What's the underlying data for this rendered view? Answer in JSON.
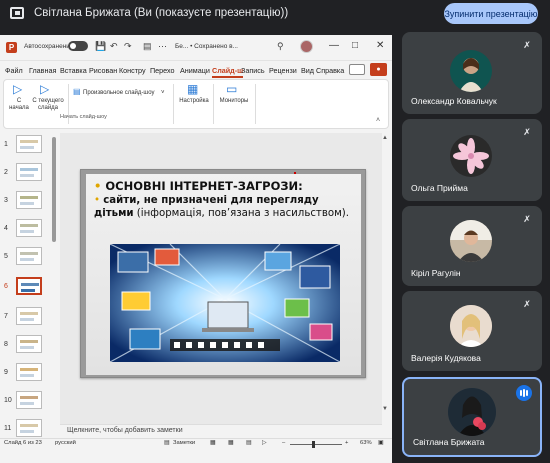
{
  "meeting": {
    "title": "Світлана Брижата (Ви (показуєте презентацію))",
    "stop_button": "Зупинити презентацію"
  },
  "ppt": {
    "autosave_label": "Автосохранение",
    "file_name": "Бе... • Сохранено в...",
    "menu": [
      "Файл",
      "Главная",
      "Вставка",
      "Рисован",
      "Констру",
      "Перехо",
      "Анимаци",
      "Слайд-ш",
      "Запись",
      "Рецензи",
      "Вид",
      "Справка"
    ],
    "active_menu_index": 7,
    "ribbon": {
      "from_start": "С начала",
      "from_current": "С текущего слайда",
      "custom_show": "Произвольное слайд-шоу",
      "settings": "Настройка",
      "monitors": "Мониторы",
      "group_label": "Начать слайд-шоу"
    },
    "thumbnails": [
      "1",
      "2",
      "3",
      "4",
      "5",
      "6",
      "7",
      "8",
      "9",
      "10",
      "11"
    ],
    "active_thumbnail": 6,
    "notes_placeholder": "Щелкните, чтобы добавить заметки",
    "status": {
      "slide_info": "Слайд 6 из 23",
      "language": "русский",
      "notes_label": "Заметки",
      "zoom": "63%"
    }
  },
  "slide": {
    "heading": "ОСНОВНІ ІНТЕРНЕТ-ЗАГРОЗИ:",
    "body_part1": "сайти,  не призначені для перегляду",
    "body_part2": "дітьми",
    "body_part3": " (інформація, пов’язана з насильством)."
  },
  "participants": [
    {
      "name": "Олександр Ковальчук",
      "muted": true,
      "avatar_color": "#0f5450"
    },
    {
      "name": "Ольга Прийма",
      "muted": true,
      "avatar_color": "#2a2a2a"
    },
    {
      "name": "Кіріл Рагулін",
      "muted": true,
      "avatar_color": "#c7b9a5"
    },
    {
      "name": "Валерія Кудякова",
      "muted": true,
      "avatar_color": "#d8c0b0"
    },
    {
      "name": "Світлана Брижата",
      "muted": false,
      "speaking": true,
      "avatar_color": "#2c3e50"
    }
  ],
  "colors": {
    "accent": "#c43e1c",
    "meet_bg": "#202124",
    "tile_bg": "#3c4043",
    "stop_button": "#a8c7fa"
  }
}
